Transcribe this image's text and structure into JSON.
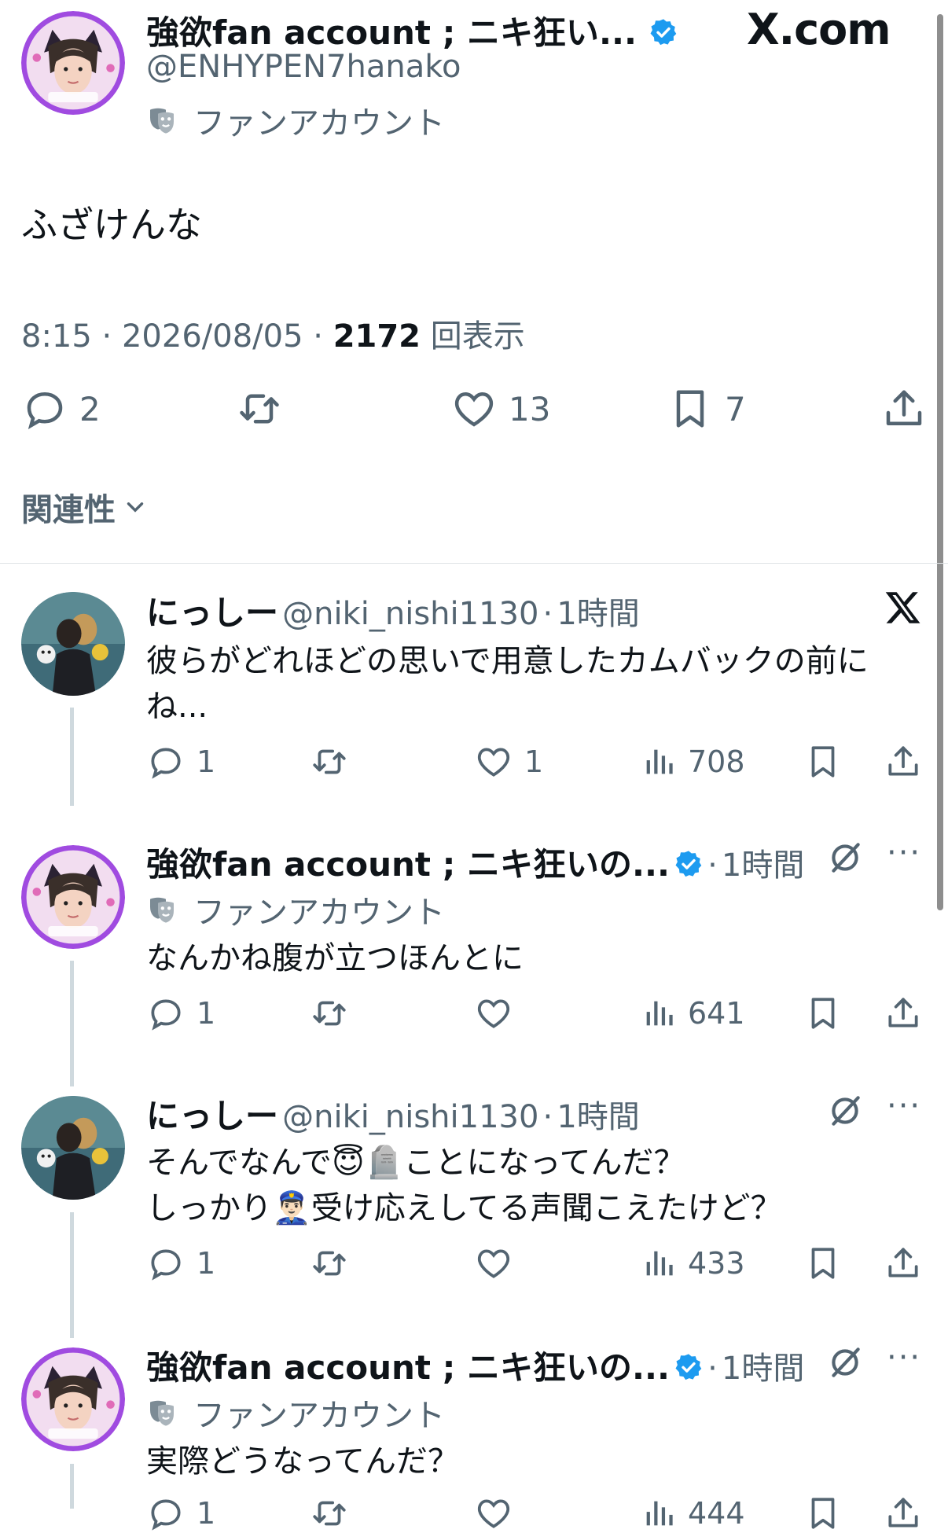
{
  "main_tweet": {
    "author_name": "強欲fan account ; ニキ狂い...",
    "handle": "@ENHYPEN7hanako",
    "label": "ファンアカウント",
    "site_badge": "X.com",
    "text": "ふざけんな",
    "time": "8:15",
    "date": "2026/08/05",
    "views_count": "2172",
    "views_label": "回表示",
    "actions": {
      "replies": "2",
      "retweets": "",
      "likes": "13",
      "bookmarks": "7"
    }
  },
  "sort": {
    "label": "関連性"
  },
  "replies": [
    {
      "author_name": "にっしー",
      "handle": "@niki_nishi1130",
      "time": "1時間",
      "label": "",
      "text_line1": "彼らがどれほどの思いで用意したカムバックの前に",
      "text_line2": "ね...",
      "replies": "1",
      "likes": "1",
      "views": "708"
    },
    {
      "author_name": "強欲fan account ; ニキ狂いの...",
      "handle": "",
      "time": "1時間",
      "label": "ファンアカウント",
      "text_line1": "なんかね腹が立つほんとに",
      "text_line2": "",
      "replies": "1",
      "likes": "",
      "views": "641"
    },
    {
      "author_name": "にっしー",
      "handle": "@niki_nishi1130",
      "time": "1時間",
      "label": "",
      "text_line1a": "そんでなんで",
      "text_line1b": "ことになってんだ？",
      "text_line2a": "しっかり",
      "text_line2b": "受け応えしてる声聞こえたけど？",
      "emoji_1": "😇",
      "emoji_2": "🪦",
      "emoji_3": "👮🏻‍♂️",
      "replies": "1",
      "likes": "",
      "views": "433"
    },
    {
      "author_name": "強欲fan account ; ニキ狂いの...",
      "handle": "",
      "time": "1時間",
      "label": "ファンアカウント",
      "text_line1": "実際どうなってんだ？",
      "text_line2": "",
      "replies": "1",
      "likes": "",
      "views": "444"
    }
  ],
  "colors": {
    "verified": "#1d9bf0",
    "text": "#0f1419",
    "secondary": "#536471",
    "avatar_ring": "#a04be0"
  },
  "icons": [
    "verified-badge-icon",
    "fan-mask-icon",
    "reply-icon",
    "retweet-icon",
    "like-icon",
    "views-icon",
    "bookmark-icon",
    "share-icon",
    "grok-icon",
    "more-icon",
    "x-logo-icon",
    "chevron-down-icon"
  ]
}
